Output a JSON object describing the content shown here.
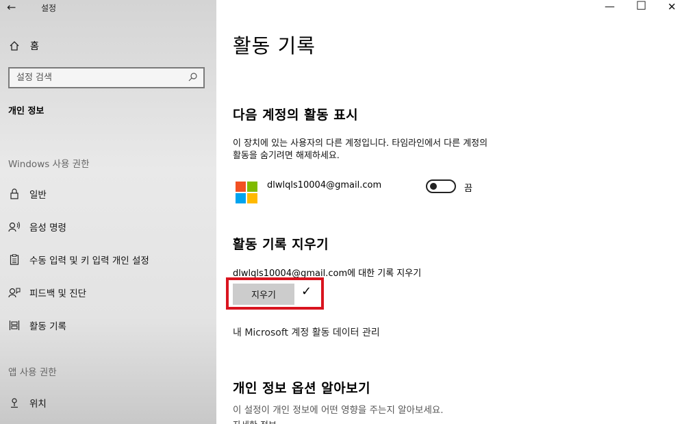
{
  "window": {
    "back_icon": "←",
    "title": "설정",
    "minimize": "—",
    "maximize": "☐",
    "close": "✕"
  },
  "sidebar": {
    "home_label": "홈",
    "search_placeholder": "설정 검색",
    "section": "개인 정보",
    "windows_group": "Windows 사용 권한",
    "items": [
      {
        "label": "일반",
        "icon": "lock-icon"
      },
      {
        "label": "음성 명령",
        "icon": "speech-icon"
      },
      {
        "label": "수동 입력 및 키 입력 개인 설정",
        "icon": "clipboard-icon"
      },
      {
        "label": "피드백 및 진단",
        "icon": "feedback-icon"
      },
      {
        "label": "활동 기록",
        "icon": "timeline-icon"
      }
    ],
    "app_group": "앱 사용 권한",
    "app_items": [
      {
        "label": "위치",
        "icon": "location-icon"
      }
    ]
  },
  "main": {
    "title": "활동 기록",
    "show_section": {
      "heading": "다음 계정의 활동 표시",
      "description_line1": "이 장치에 있는 사용자의 다른 계정입니다. 타임라인에서 다른 계정의",
      "description_line2": "활동을 숨기려면 해제하세요.",
      "account_email": "dlwlqls10004@gmail.com",
      "toggle_state": "끔"
    },
    "clear_section": {
      "heading": "활동 기록 지우기",
      "label": "dlwlqls10004@gmail.com에 대한 기록 지우기",
      "button": "지우기",
      "check": "✓"
    },
    "ms_link": "내 Microsoft 계정 활동 데이터 관리",
    "privacy_section": {
      "heading": "개인 정보 옵션 알아보기",
      "description": "이 설정이 개인 정보에 어떤 영향을 주는지 알아보세요.",
      "link_partial": "자세한 정보"
    }
  },
  "colors": {
    "highlight": "#d9141f",
    "ms_red": "#f25022",
    "ms_green": "#7fba00",
    "ms_blue": "#00a4ef",
    "ms_yellow": "#ffb900"
  }
}
